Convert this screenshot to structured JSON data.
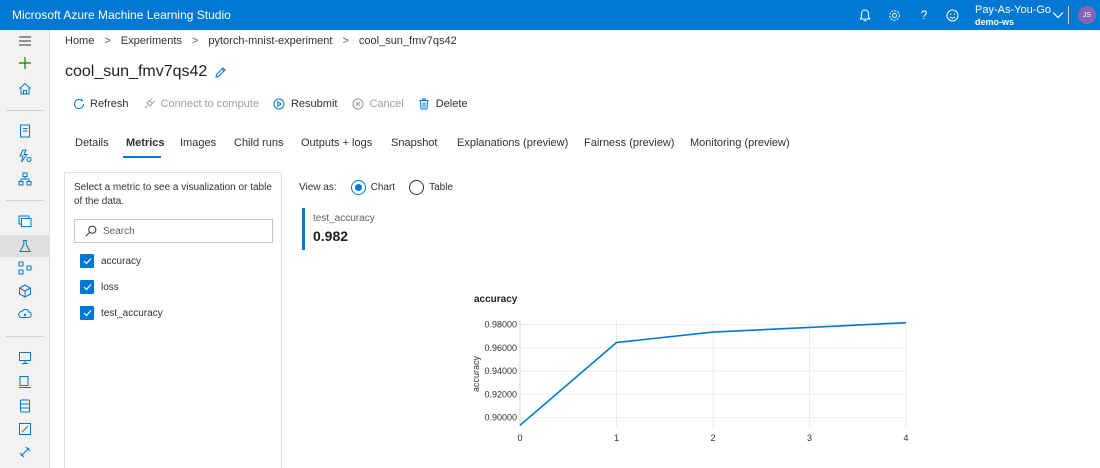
{
  "app": {
    "title": "Microsoft Azure Machine Learning Studio"
  },
  "header": {
    "subscription": "Pay-As-You-Go",
    "workspace": "demo-ws",
    "avatar_initials": "JS",
    "icons": [
      "bell-icon",
      "gear-icon",
      "help-icon",
      "feedback-smiley-icon",
      "chevron-down-icon"
    ]
  },
  "rail": {
    "icons": [
      "hamburger-icon",
      "plus-icon",
      "home-icon",
      "notebook-icon",
      "automl-icon",
      "designer-icon",
      "datasets-icon",
      "experiments-icon",
      "pipelines-icon",
      "models-icon",
      "endpoints-icon",
      "compute-icon",
      "environments-icon",
      "datastores-icon",
      "labeling-icon",
      "linked-services-icon"
    ]
  },
  "breadcrumb": {
    "items": [
      "Home",
      "Experiments",
      "pytorch-mnist-experiment",
      "cool_sun_fmv7qs42"
    ]
  },
  "page": {
    "title": "cool_sun_fmv7qs42"
  },
  "toolbar": {
    "refresh": "Refresh",
    "connect": "Connect to compute",
    "resubmit": "Resubmit",
    "cancel": "Cancel",
    "delete": "Delete"
  },
  "tabs": [
    "Details",
    "Metrics",
    "Images",
    "Child runs",
    "Outputs + logs",
    "Snapshot",
    "Explanations (preview)",
    "Fairness (preview)",
    "Monitoring (preview)"
  ],
  "metrics_panel": {
    "description": "Select a metric to see a visualization or table of the data.",
    "search_placeholder": "Search",
    "items": [
      "accuracy",
      "loss",
      "test_accuracy"
    ]
  },
  "view_as": {
    "label": "View as:",
    "chart": "Chart",
    "table": "Table",
    "selected": "Chart"
  },
  "kpi": {
    "label": "test_accuracy",
    "value": "0.982"
  },
  "colors": {
    "accent": "#0078d4",
    "avatar": "#8764b8"
  },
  "chart_data": {
    "type": "line",
    "title": "accuracy",
    "ylabel": "accuracy",
    "xlabel": "",
    "x": [
      0,
      1,
      2,
      3,
      4
    ],
    "series": [
      {
        "values": [
          0.8935,
          0.9645,
          0.9735,
          0.9775,
          0.9815
        ]
      }
    ],
    "y_ticks": [
      "0.90000",
      "0.92000",
      "0.94000",
      "0.96000",
      "0.98000"
    ],
    "x_ticks": [
      "0",
      "1",
      "2",
      "3",
      "4"
    ],
    "ylim": [
      0.892,
      0.983
    ],
    "xlim": [
      0,
      4
    ],
    "grid": true
  }
}
